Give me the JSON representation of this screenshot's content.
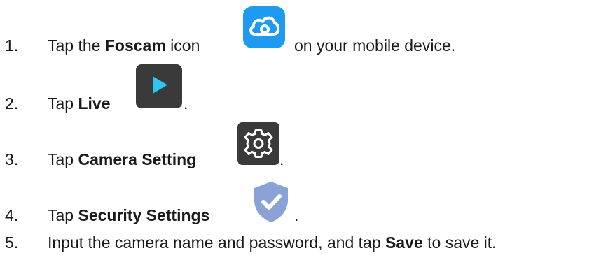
{
  "steps": [
    {
      "number": "1.",
      "before": "Tap the ",
      "bold": "Foscam",
      "after": " icon",
      "tail": "on your mobile device.",
      "icon": "foscam-cloud-icon",
      "icon_color": "#1e9af0"
    },
    {
      "number": "2.",
      "before": "Tap ",
      "bold": "Live",
      "after": "",
      "tail": ".",
      "icon": "play-icon",
      "icon_color": "#3a3a3a",
      "accent": "#2ec4f0"
    },
    {
      "number": "3.",
      "before": "Tap ",
      "bold": "Camera Setting",
      "after": "",
      "tail": ".",
      "icon": "gear-icon",
      "icon_color": "#3a3a3a"
    },
    {
      "number": "4.",
      "before": "Tap ",
      "bold": "Security Settings",
      "after": "",
      "tail": ".",
      "icon": "shield-check-icon",
      "icon_color": "#8aa2d6"
    },
    {
      "number": "5.",
      "before": "Input the camera name and password, and tap ",
      "bold": "Save",
      "after": " to save it."
    }
  ]
}
